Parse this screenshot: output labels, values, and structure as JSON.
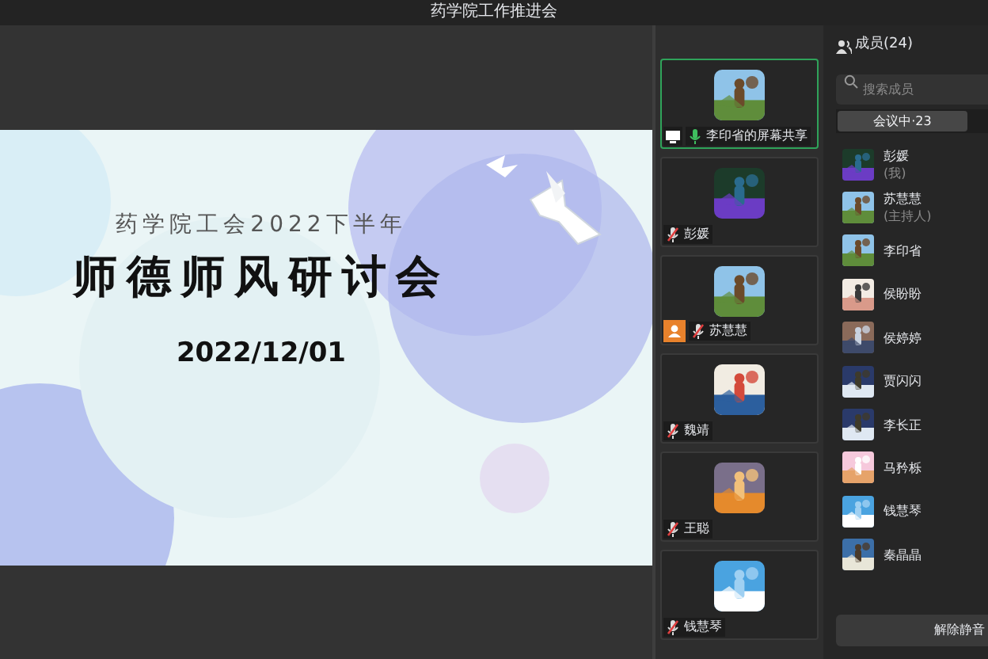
{
  "window": {
    "title": "药学院工作推进会"
  },
  "slide": {
    "subtitle": "药学院工会2022下半年",
    "title": "师德师风研讨会",
    "date": "2022/12/01"
  },
  "video_tiles": [
    {
      "name": "李印省的屏幕共享",
      "selected": true,
      "muted": false,
      "sharing": true,
      "host": false
    },
    {
      "name": "彭媛",
      "selected": false,
      "muted": true,
      "sharing": false,
      "host": false
    },
    {
      "name": "苏慧慧",
      "selected": false,
      "muted": true,
      "sharing": false,
      "host": true
    },
    {
      "name": "魏靖",
      "selected": false,
      "muted": true,
      "sharing": false,
      "host": false
    },
    {
      "name": "王聪",
      "selected": false,
      "muted": true,
      "sharing": false,
      "host": false
    },
    {
      "name": "钱慧琴",
      "selected": false,
      "muted": true,
      "sharing": false,
      "host": false
    }
  ],
  "members_panel": {
    "header": "成员(24)",
    "search": {
      "placeholder": "搜索成员"
    },
    "tabs": [
      {
        "label": "会议中·23",
        "selected": true
      }
    ],
    "members": [
      {
        "name": "彭媛",
        "note": "(我)"
      },
      {
        "name": "苏慧慧",
        "note": "(主持人)"
      },
      {
        "name": "李印省"
      },
      {
        "name": "侯盼盼"
      },
      {
        "name": "侯婷婷"
      },
      {
        "name": "贾闪闪"
      },
      {
        "name": "李长正"
      },
      {
        "name": "马矜栎"
      },
      {
        "name": "钱慧琴"
      },
      {
        "name": "秦晶晶"
      }
    ],
    "unmute_button": "解除静音"
  }
}
